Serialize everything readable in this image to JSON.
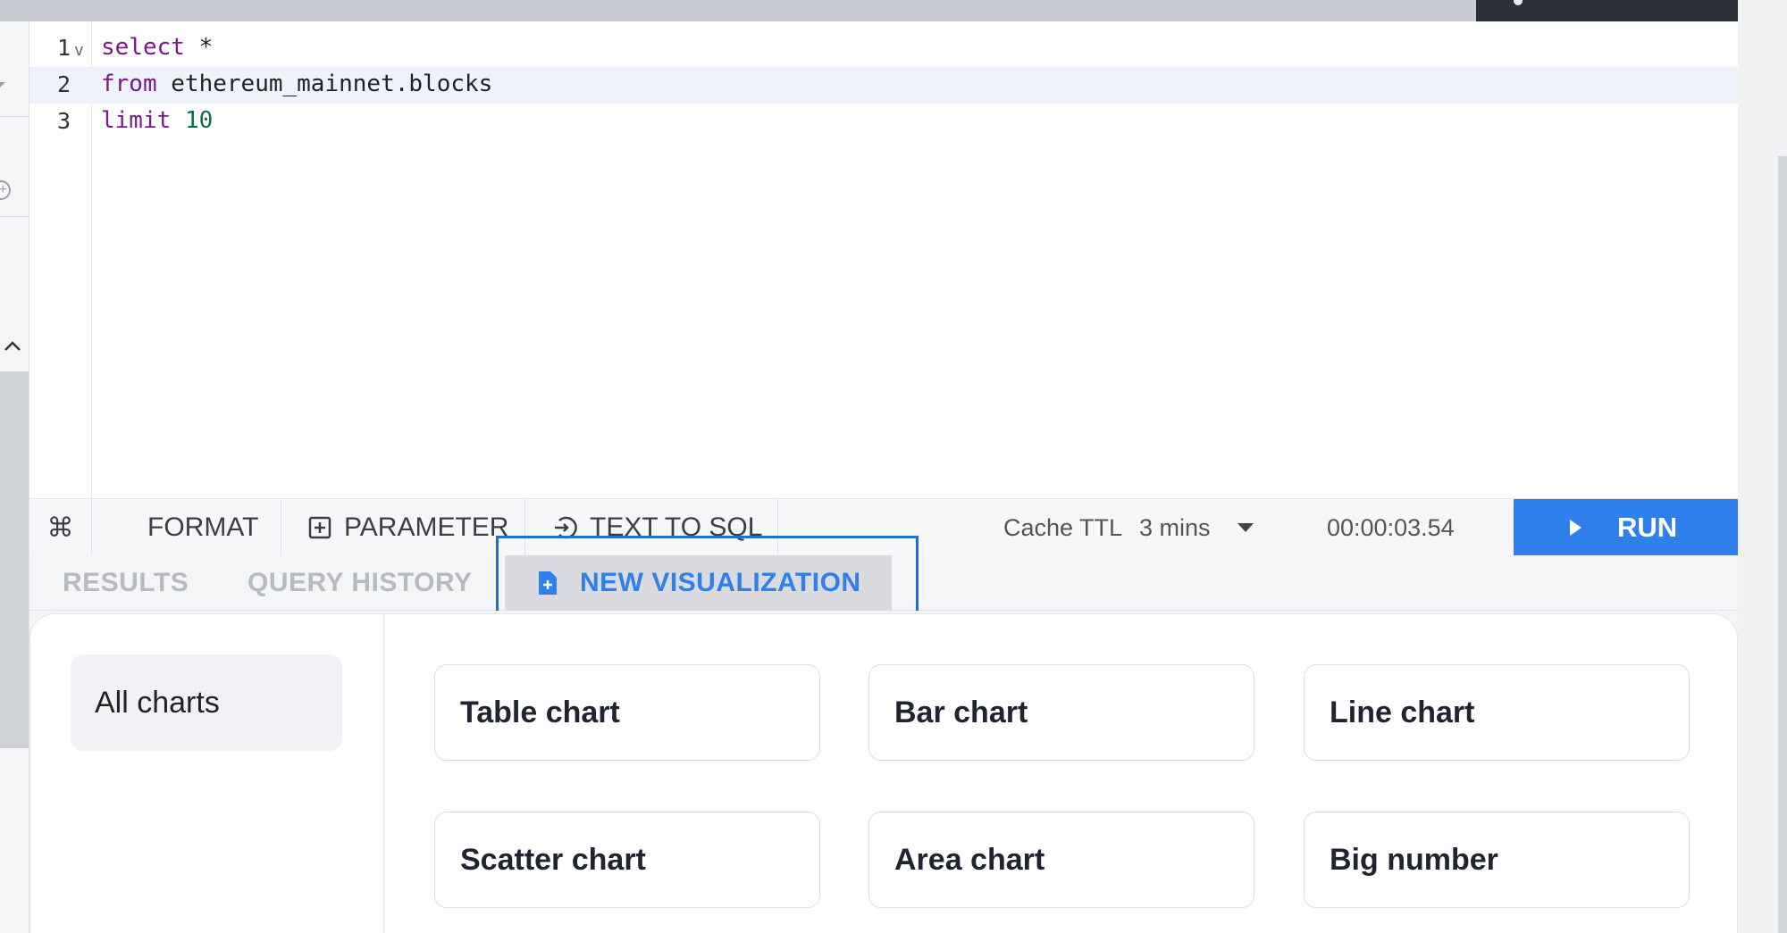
{
  "editor": {
    "lines": [
      {
        "num": "1",
        "kw": "select",
        "rest": " *",
        "num_lit": ""
      },
      {
        "num": "2",
        "kw": "from",
        "rest": " ethereum_mainnet.blocks",
        "num_lit": ""
      },
      {
        "num": "3",
        "kw": "limit",
        "rest": " ",
        "num_lit": "10"
      }
    ],
    "fold_glyph": "v"
  },
  "toolbar": {
    "cmd_glyph": "⌘",
    "format_label": "FORMAT",
    "parameter_label": "PARAMETER",
    "text_to_sql_label": "TEXT TO SQL",
    "cache_label": "Cache TTL",
    "cache_value": "3 mins",
    "timer": "00:00:03.54",
    "run_label": "RUN"
  },
  "tabs": {
    "results": "RESULTS",
    "history": "QUERY HISTORY",
    "new_viz": "NEW VISUALIZATION"
  },
  "panel": {
    "category": "All charts",
    "charts": [
      "Table chart",
      "Bar chart",
      "Line chart",
      "Scatter chart",
      "Area chart",
      "Big number"
    ]
  },
  "colors": {
    "accent": "#2f80ed",
    "keyword": "#7a1a86",
    "number": "#0b6e4f"
  }
}
